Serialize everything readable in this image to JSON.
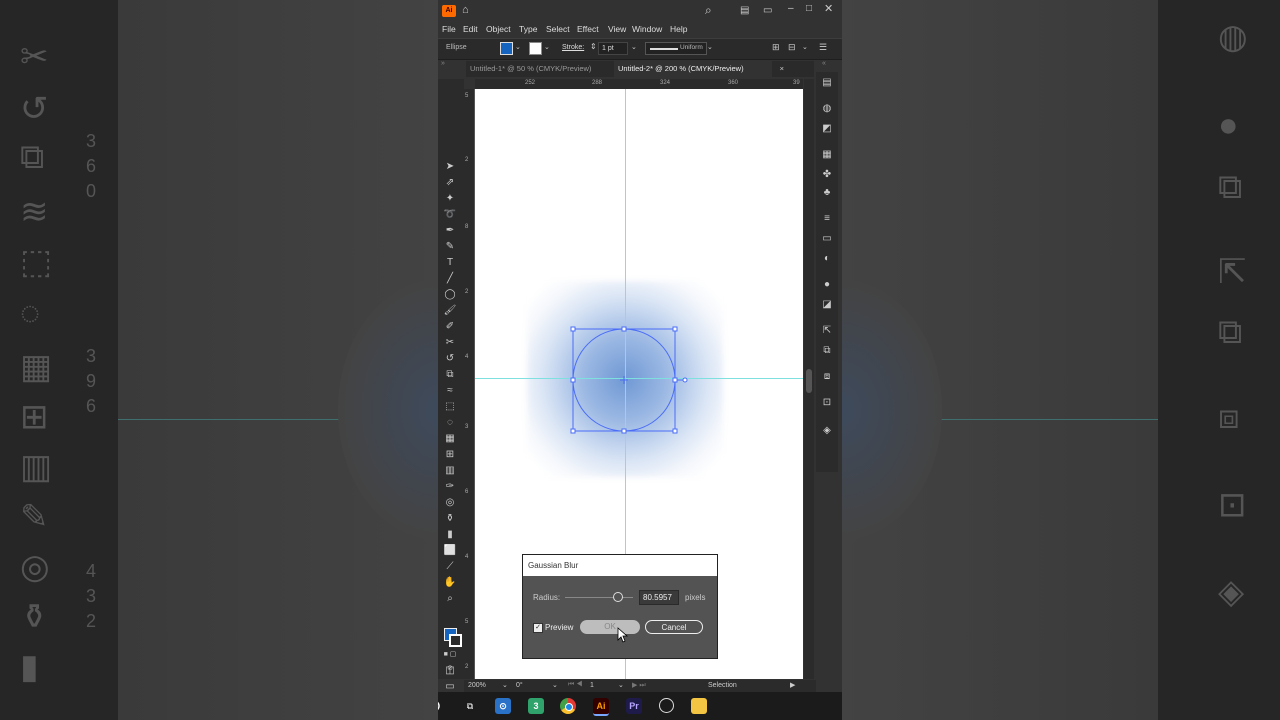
{
  "app": {
    "logo": "Ai",
    "menu": [
      "File",
      "Edit",
      "Object",
      "Type",
      "Select",
      "Effect",
      "View",
      "Window",
      "Help"
    ],
    "control": {
      "selection_label": "Ellipse",
      "stroke_label": "Stroke:",
      "stroke_weight": "1 pt",
      "profile_label": "Uniform",
      "fill_color": "#1565c0"
    },
    "tabs": [
      {
        "label": "Untitled-1* @ 50 % (CMYK/Preview)",
        "active": false
      },
      {
        "label": "Untitled-2* @ 200 % (CMYK/Preview)",
        "active": true
      }
    ],
    "tab_close": "×",
    "ruler_top": [
      "252",
      "288",
      "324",
      "360",
      "39"
    ],
    "ruler_left": [
      "5",
      "2",
      "8",
      "2",
      "4",
      "3",
      "6",
      "4",
      "5",
      "2"
    ],
    "status": {
      "zoom": "200%",
      "rotation": "0°",
      "artboard": "1",
      "tool": "Selection"
    }
  },
  "dialog": {
    "title": "Gaussian Blur",
    "radius_label": "Radius:",
    "radius_value": "80.5957",
    "radius_unit": "pixels",
    "preview_label": "Preview",
    "preview_checked": true,
    "ok_label": "OK",
    "cancel_label": "Cancel"
  },
  "taskbar": {
    "icons": [
      "task-view-icon",
      "store-icon",
      "app3-icon",
      "chrome-icon",
      "illustrator-icon",
      "premiere-icon",
      "obs-icon",
      "file-explorer-icon"
    ],
    "labels": {
      "ai": "Ai",
      "pr": "Pr",
      "three": "3"
    }
  },
  "backdrop": {
    "left_digits": [
      "3",
      "6",
      "0",
      "3",
      "9",
      "6",
      "4",
      "3",
      "2"
    ]
  },
  "colors": {
    "accent": "#1565c0",
    "selection": "#4a6cf7",
    "guide": "#7fe0e0",
    "blur": "#6f98d4"
  }
}
